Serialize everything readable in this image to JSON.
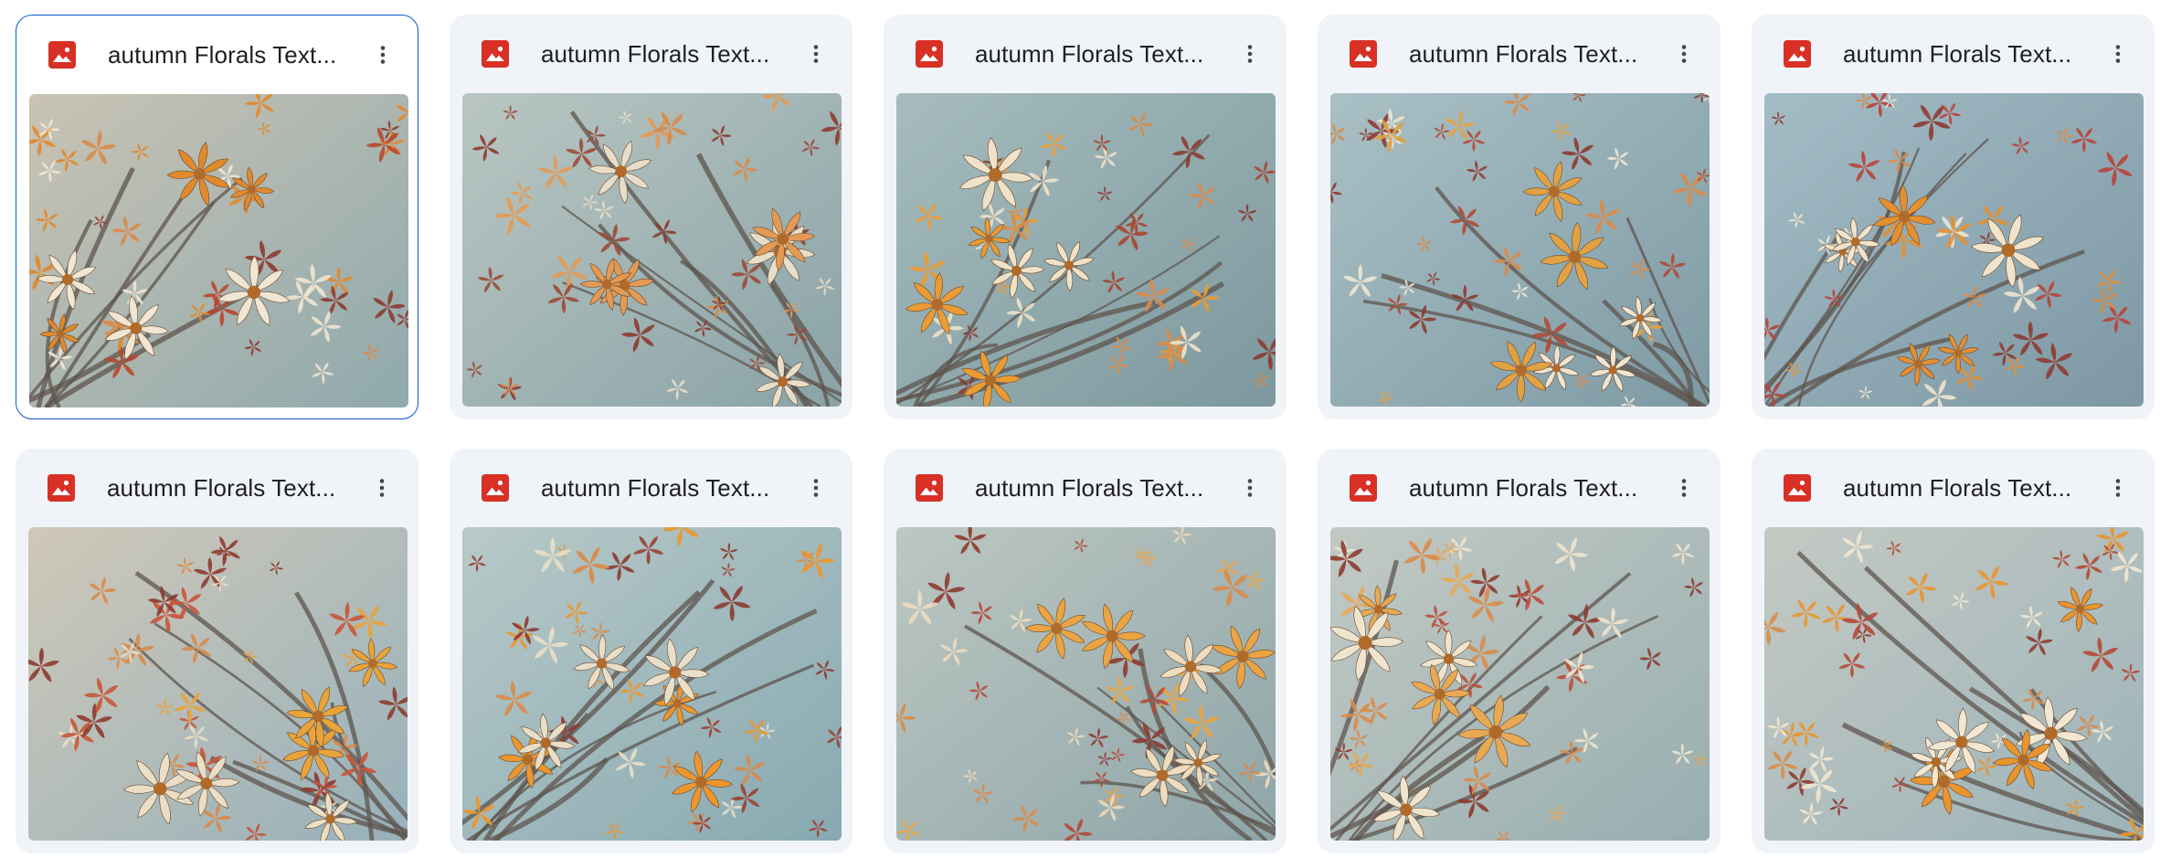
{
  "files": [
    {
      "name": "autumn Florals Text...",
      "selected": true,
      "palette": {
        "bg1": "#c9c3b4",
        "bg2": "#8fa9ad",
        "flower1": "#e08a2c",
        "flower2": "#efe6d3",
        "leaf": "#b8472f"
      }
    },
    {
      "name": "autumn Florals Text...",
      "selected": false,
      "palette": {
        "bg1": "#b9c6c2",
        "bg2": "#8aa3a7",
        "flower1": "#e39a55",
        "flower2": "#e7ddc8",
        "leaf": "#9c4a38"
      }
    },
    {
      "name": "autumn Florals Text...",
      "selected": false,
      "palette": {
        "bg1": "#a6bcbd",
        "bg2": "#7c989e",
        "flower1": "#ea9b33",
        "flower2": "#efe2c8",
        "leaf": "#a8452f"
      }
    },
    {
      "name": "autumn Florals Text...",
      "selected": false,
      "palette": {
        "bg1": "#a9c0c5",
        "bg2": "#7e9aa4",
        "flower1": "#e2a244",
        "flower2": "#efe5d0",
        "leaf": "#b04a35"
      }
    },
    {
      "name": "autumn Florals Text...",
      "selected": false,
      "palette": {
        "bg1": "#a3bcc6",
        "bg2": "#7d98a3",
        "flower1": "#e39033",
        "flower2": "#f0e4cc",
        "leaf": "#b84238"
      }
    },
    {
      "name": "autumn Florals Text...",
      "selected": false,
      "palette": {
        "bg1": "#cfc8b8",
        "bg2": "#97b1bb",
        "flower1": "#e8a43a",
        "flower2": "#eadfc6",
        "leaf": "#c8553a"
      }
    },
    {
      "name": "autumn Florals Text...",
      "selected": false,
      "palette": {
        "bg1": "#b8c9c8",
        "bg2": "#87a9b1",
        "flower1": "#eb962e",
        "flower2": "#e9dfc8",
        "leaf": "#9a4033"
      }
    },
    {
      "name": "autumn Florals Text...",
      "selected": false,
      "palette": {
        "bg1": "#bdc7c2",
        "bg2": "#8ea5a8",
        "flower1": "#eba443",
        "flower2": "#eddcc0",
        "leaf": "#b5493a"
      }
    },
    {
      "name": "autumn Florals Text...",
      "selected": false,
      "palette": {
        "bg1": "#c2c9c4",
        "bg2": "#97aeb0",
        "flower1": "#e8a954",
        "flower2": "#efe4cd",
        "leaf": "#b8503c"
      }
    },
    {
      "name": "autumn Florals Text...",
      "selected": false,
      "palette": {
        "bg1": "#c4c9c3",
        "bg2": "#9cb3b9",
        "flower1": "#e8952f",
        "flower2": "#f1e7d2",
        "leaf": "#b24a36"
      }
    }
  ],
  "icons": {
    "file_type": "image-file-icon",
    "more": "more-vert-icon"
  },
  "colors": {
    "image_icon_red": "#d93025",
    "selected_border": "#0b57d0",
    "card_bg": "#f0f4f9"
  }
}
